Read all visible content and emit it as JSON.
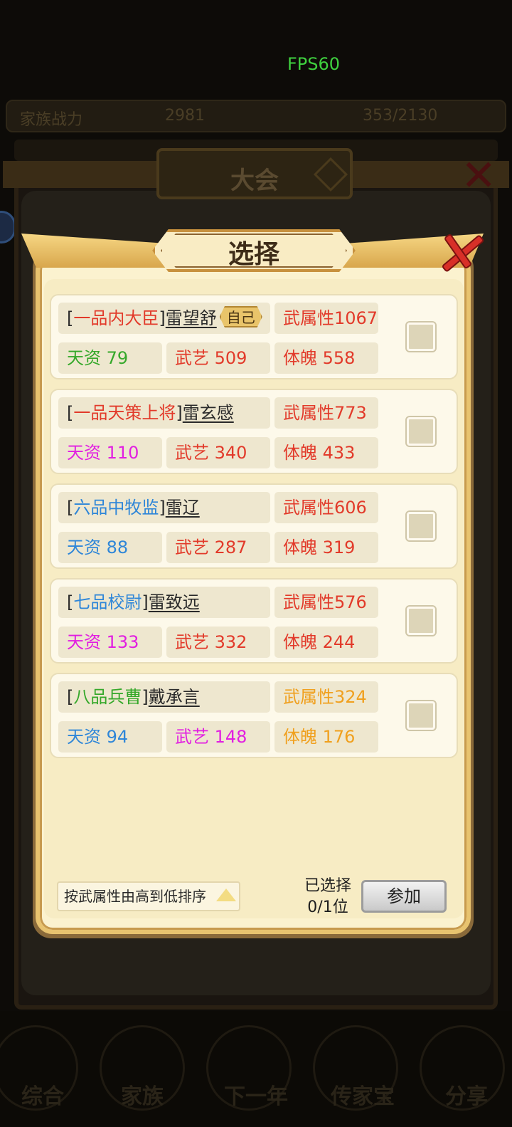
{
  "fps_label": "FPS60",
  "background": {
    "topbar_left": "家族战力",
    "topbar_mid": "2981",
    "topbar_right": "353/2130",
    "outer_title": "大会",
    "bottom_tabs": [
      "综合",
      "家族",
      "下一年",
      "传家宝",
      "分享"
    ]
  },
  "dialog": {
    "title": "选择",
    "close_icon": "close-x-icon"
  },
  "candidates": [
    {
      "rank": "一品内大臣",
      "rank_color": "red",
      "name": "雷望舒",
      "self_tag": "自己",
      "attr": "武属性1067",
      "attr_color": "red",
      "talent": "天资 79",
      "talent_color": "green",
      "skill": "武艺 509",
      "skill_color": "red",
      "body": "体魄 558",
      "body_color": "red"
    },
    {
      "rank": "一品天策上将",
      "rank_color": "red",
      "name": "雷玄感",
      "self_tag": "",
      "attr": "武属性773",
      "attr_color": "red",
      "talent": "天资 110",
      "talent_color": "magenta",
      "skill": "武艺 340",
      "skill_color": "red",
      "body": "体魄 433",
      "body_color": "red"
    },
    {
      "rank": "六品中牧监",
      "rank_color": "blue",
      "name": "雷辽",
      "self_tag": "",
      "attr": "武属性606",
      "attr_color": "red",
      "talent": "天资 88",
      "talent_color": "blue",
      "skill": "武艺 287",
      "skill_color": "red",
      "body": "体魄 319",
      "body_color": "red"
    },
    {
      "rank": "七品校尉",
      "rank_color": "blue",
      "name": "雷致远",
      "self_tag": "",
      "attr": "武属性576",
      "attr_color": "red",
      "talent": "天资 133",
      "talent_color": "magenta",
      "skill": "武艺 332",
      "skill_color": "red",
      "body": "体魄 244",
      "body_color": "red"
    },
    {
      "rank": "八品兵曹",
      "rank_color": "green",
      "name": "戴承言",
      "self_tag": "",
      "attr": "武属性324",
      "attr_color": "orange",
      "talent": "天资 94",
      "talent_color": "blue",
      "skill": "武艺 148",
      "skill_color": "magenta",
      "body": "体魄 176",
      "body_color": "orange"
    }
  ],
  "footer": {
    "sort_label": "按武属性由高到低排序",
    "selected_line1": "已选择",
    "selected_line2": "0/1位",
    "join_label": "参加"
  }
}
